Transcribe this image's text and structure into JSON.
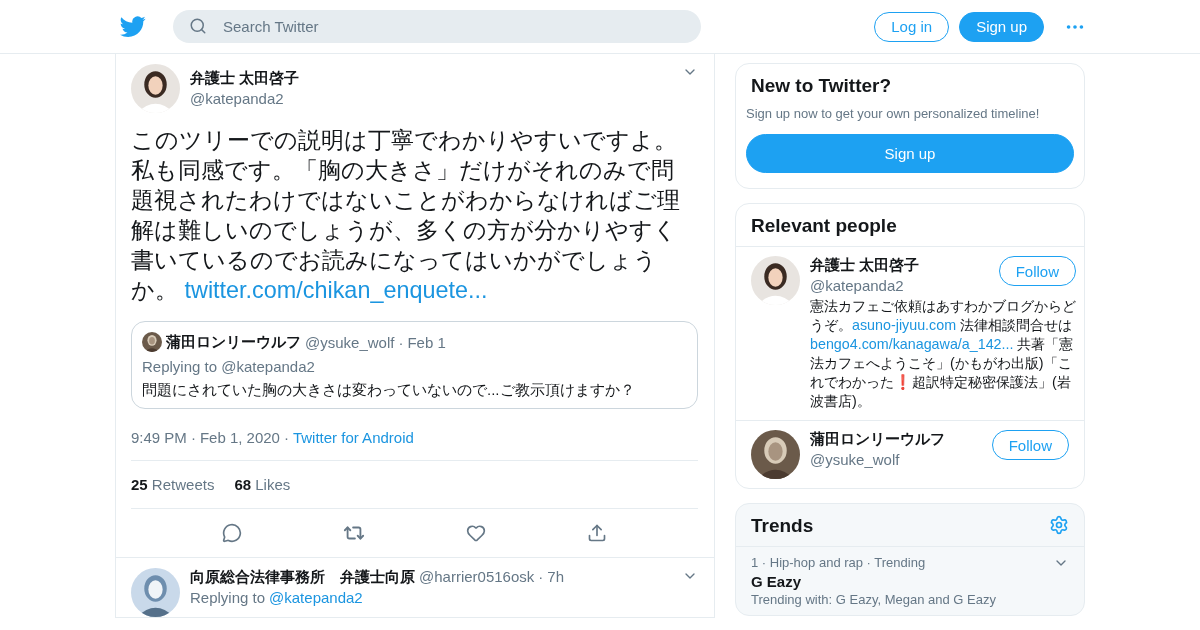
{
  "header": {
    "search_placeholder": "Search Twitter",
    "login": "Log in",
    "signup": "Sign up"
  },
  "tweet": {
    "name": "弁護士 太田啓子",
    "handle": "@katepanda2",
    "paragraphs": [
      "このツリーでの説明は丁寧でわかりやすいですよ。",
      "私も同感です。「胸の大きさ」だけがそれのみで問題視されたわけではないことがわからなければご理解は難しいのでしょうが、多くの方が分かりやすく書いているのでお読みになってはいかがでしょうか。"
    ],
    "link": "twitter.com/chikan_enquete...",
    "quoted": {
      "name": "蒲田ロンリーウルフ",
      "handle": "@ysuke_wolf",
      "separator": "·",
      "date": "Feb 1",
      "replying_label": "Replying to @katepanda2",
      "text": "問題にされていた胸の大きさは変わっていないので...ご教示頂けますか？"
    },
    "meta": [
      {
        "kind": "text",
        "text": "9:49 PM"
      },
      {
        "kind": "sep",
        "text": "·"
      },
      {
        "kind": "text",
        "text": "Feb 1, 2020"
      },
      {
        "kind": "sep",
        "text": "·"
      },
      {
        "kind": "link",
        "text": "Twitter for Android"
      }
    ],
    "stats": [
      {
        "count": "25",
        "label": "Retweets"
      },
      {
        "count": "68",
        "label": "Likes"
      }
    ]
  },
  "reply": {
    "name": "向原総合法律事務所　弁護士向原",
    "handle": "@harrier0516osk",
    "separator": "·",
    "time": "7h",
    "replying_label": "Replying to",
    "replying_handle": "@katepanda2"
  },
  "signup_card": {
    "title": "New to Twitter?",
    "subtitle": "Sign up now to get your own personalized timeline!",
    "button": "Sign up"
  },
  "people": {
    "title": "Relevant people",
    "items": [
      {
        "name": "弁護士 太田啓子",
        "handle": "@katepanda2",
        "follow": "Follow",
        "bio": [
          {
            "kind": "text",
            "text": "憲法カフェご依頼はあすわかブログからどうぞ。"
          },
          {
            "kind": "link",
            "text": "asuno-jiyuu.com"
          },
          {
            "kind": "text",
            "text": " 法律相談問合せは"
          },
          {
            "kind": "link",
            "text": "bengo4.com/kanagawa/a_142..."
          },
          {
            "kind": "text",
            "text": " 共著「憲法カフェへようこそ」(かもがわ出版)「これでわかった❗超訳特定秘密保護法」(岩波書店)。"
          }
        ]
      },
      {
        "name": "蒲田ロンリーウルフ",
        "handle": "@ysuke_wolf",
        "follow": "Follow"
      }
    ]
  },
  "trends": {
    "title": "Trends",
    "items": [
      {
        "meta": "1 · Hip-hop and rap · Trending",
        "name": "G Eazy",
        "context": "Trending with: G Eazy, Megan and G Eazy"
      }
    ]
  }
}
